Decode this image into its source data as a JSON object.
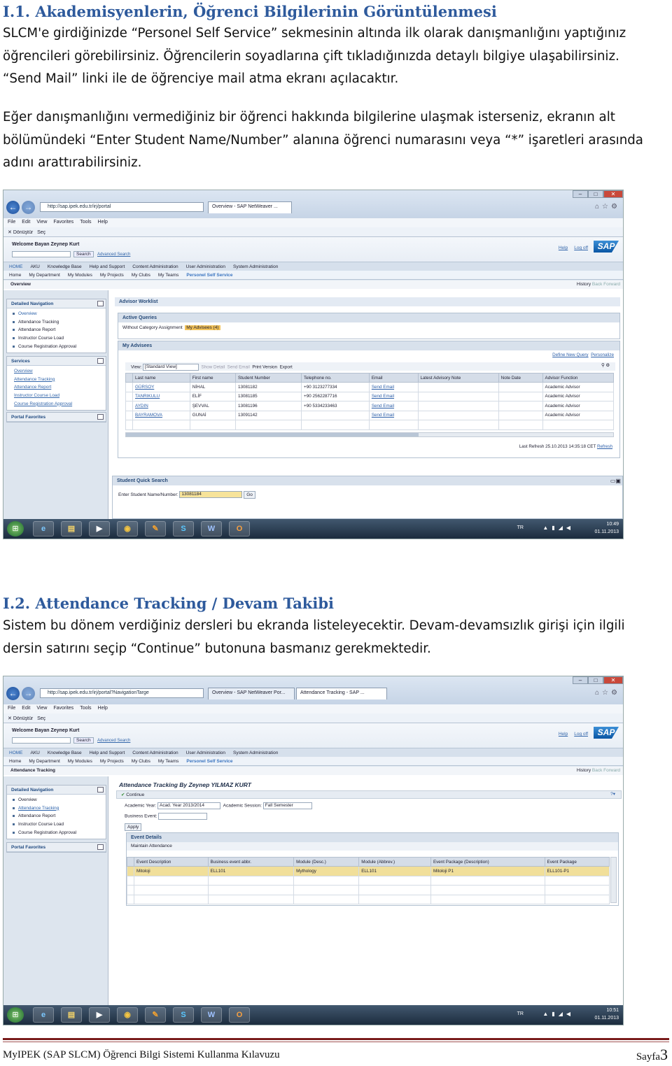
{
  "section1": {
    "heading": "I.1. Akademisyenlerin, Öğrenci Bilgilerinin Görüntülenmesi",
    "para1_lines": [
      "SLCM'e girdiğinizde “Personel Self Service” sekmesinin altında ilk olarak danışmanlığını yaptığınız",
      "öğrencileri görebilirsiniz. Öğrencilerin soyadlarına çift tıkladığınızda detaylı bilgiye ulaşabilirsiniz.",
      "“Send Mail” linki ile de öğrenciye mail atma ekranı açılacaktır."
    ],
    "para2_lines": [
      "Eğer danışmanlığını vermediğiniz bir öğrenci hakkında bilgilerine ulaşmak isterseniz, ekranın alt",
      "bölümündeki “Enter Student Name/Number” alanına öğrenci numarasını veya “*” işaretleri arasında",
      "adını arattırabilirsiniz."
    ]
  },
  "shot1": {
    "address": "http://sap.ipek.edu.tr/irj/portal",
    "tab": "Overview - SAP NetWeaver ...",
    "menu": [
      "File",
      "Edit",
      "View",
      "Favorites",
      "Tools",
      "Help"
    ],
    "favbar": [
      "Dönüştür",
      "Seç"
    ],
    "welcome": "Welcome Bayan Zeynep Kurt",
    "search_btn": "Search",
    "adv_search": "Advanced Search",
    "help": "Help",
    "logoff": "Log off",
    "logo": "SAP",
    "top_nav": [
      "HOME",
      "AKU",
      "Knowledge Base",
      "Help and Support",
      "Content Administration",
      "User Administration",
      "System Administration"
    ],
    "sub_nav": [
      "Home",
      "My Department",
      "My Modules",
      "My Projects",
      "My Clubs",
      "My Teams",
      "Personel Self Service"
    ],
    "crumb": "Overview",
    "history": "History",
    "back": "Back",
    "forward": "Forward",
    "detailed_nav": "Detailed Navigation",
    "nav_items": [
      "Overview",
      "Attendance Tracking",
      "Attendance Report",
      "Instructor Course Load",
      "Course Registration Approval"
    ],
    "services": "Services",
    "service_links": [
      "Overview",
      "Attendance Tracking",
      "Attendance Report",
      "Instructor Course Load",
      "Course Registration Approval"
    ],
    "portal_favs": "Portal Favorites",
    "worklist": "Advisor Worklist",
    "active_queries": "Active Queries",
    "without_cat": "Without Category Assignment",
    "my_advisees_link": "My Advisees (4)",
    "my_advisees": "My Advisees",
    "define_query": "Define New Query",
    "personalize": "Personalize",
    "view_label": "View:",
    "view_value": "[Standard View]",
    "show_detail": "Show Detail",
    "send_email": "Send Email",
    "print_version": "Print Version",
    "export": "Export",
    "columns": [
      "Last name",
      "First name",
      "Student Number",
      "Telephone no.",
      "Email",
      "Latest Advisory Note",
      "Note Date",
      "Advisor Function"
    ],
    "rows": [
      [
        "GÜRSOY",
        "NİHAL",
        "13081182",
        "+90 3123277334",
        "Send Email",
        "",
        "",
        "Academic Advisor"
      ],
      [
        "TANRIKULU",
        "ELİF",
        "13081185",
        "+90 2562287716",
        "Send Email",
        "",
        "",
        "Academic Advisor"
      ],
      [
        "AYDIN",
        "ŞEVVAL",
        "13081196",
        "+90 5334233463",
        "Send Email",
        "",
        "",
        "Academic Advisor"
      ],
      [
        "BAYRAMOVA",
        "GUNAİ",
        "13091142",
        "",
        "Send Email",
        "",
        "",
        "Academic Advisor"
      ]
    ],
    "last_refresh": "Last Refresh 25.10.2013 14:35:18 CET",
    "refresh": "Refresh",
    "quick_search": "Student Quick Search",
    "enter_label": "Enter Student Name/Number:",
    "enter_value": "13081184",
    "go": "Go",
    "tray_lang": "TR",
    "tray_time": "10:49",
    "tray_date": "01.11.2013"
  },
  "section2": {
    "heading": "I.2. Attendance Tracking / Devam Takibi",
    "para_lines": [
      "Sistem bu dönem verdiğiniz dersleri bu ekranda listeleyecektir. Devam-devamsızlık girişi için ilgili",
      "dersin satırını seçip “Continue” butonuna basmanız gerekmektedir."
    ]
  },
  "shot2": {
    "address": "http://sap.ipek.edu.tr/irj/portal?NavigationTarge",
    "tab1": "Overview - SAP NetWeaver Por...",
    "tab2": "Attendance Tracking - SAP ...",
    "crumb": "Attendance Tracking",
    "nav_items": [
      "Overview",
      "Attendance Tracking",
      "Attendance Report",
      "Instructor Course Load",
      "Course Registration Approval"
    ],
    "title": "Attendance Tracking By Zeynep YILMAZ KURT",
    "continue": "Continue",
    "acad_year_label": "Academic Year:",
    "acad_year": "Acad. Year 2013/2014",
    "acad_session_label": "Academic Session:",
    "acad_session": "Fall Semester",
    "business_event_label": "Business Event:",
    "apply": "Apply",
    "event_details": "Event Details",
    "maintain": "Maintain Attendance",
    "columns": [
      "Event Description",
      "Business event abbr.",
      "Module (Desc.)",
      "Module (Abbrev.)",
      "Event Package (Description)",
      "Event Package"
    ],
    "row": [
      "Mitoloji",
      "ELL101",
      "Mythology",
      "ELL101",
      "Mitoloji P1",
      "ELL101-P1"
    ],
    "tray_time": "10:51",
    "tray_date": "01.11.2013"
  },
  "footer": {
    "text": "MyIPEK (SAP SLCM) Öğrenci Bilgi Sistemi Kullanma Kılavuzu",
    "page_label": "Sayfa",
    "page_num": "3"
  }
}
